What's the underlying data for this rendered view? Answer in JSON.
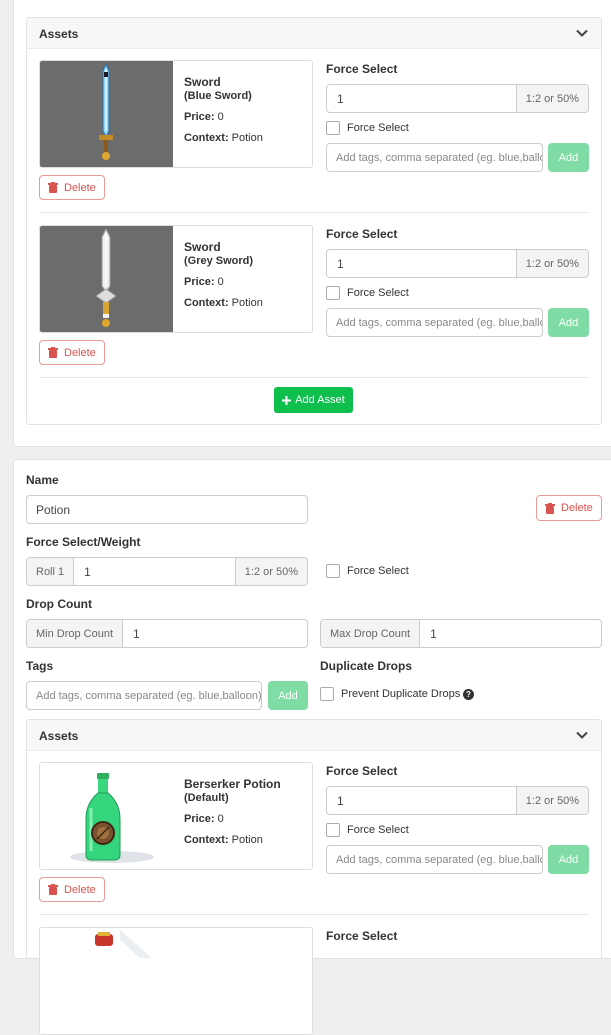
{
  "top_panel": {
    "assets_title": "Assets",
    "assets": [
      {
        "name": "Sword",
        "variant": "(Blue Sword)",
        "price_label": "Price:",
        "price": "0",
        "context_label": "Context:",
        "context": "Potion",
        "force_select_label": "Force Select",
        "weight_value": "1",
        "weight_hint": "1:2 or 50%",
        "force_select_checkbox": "Force Select",
        "tags_placeholder": "Add tags, comma separated (eg. blue,ballo",
        "add_label": "Add",
        "delete_label": "Delete"
      },
      {
        "name": "Sword",
        "variant": "(Grey Sword)",
        "price_label": "Price:",
        "price": "0",
        "context_label": "Context:",
        "context": "Potion",
        "force_select_label": "Force Select",
        "weight_value": "1",
        "weight_hint": "1:2 or 50%",
        "force_select_checkbox": "Force Select",
        "tags_placeholder": "Add tags, comma separated (eg. blue,ballo",
        "add_label": "Add",
        "delete_label": "Delete"
      }
    ],
    "add_asset_label": "Add Asset"
  },
  "group": {
    "name_label": "Name",
    "name_value": "Potion",
    "delete_label": "Delete",
    "force_weight_label": "Force Select/Weight",
    "roll_addon": "Roll 1",
    "roll_value": "1",
    "roll_hint": "1:2 or 50%",
    "force_select_checkbox": "Force Select",
    "drop_count_label": "Drop Count",
    "min_addon": "Min Drop Count",
    "min_value": "1",
    "max_addon": "Max Drop Count",
    "max_value": "1",
    "tags_label": "Tags",
    "tags_placeholder": "Add tags, comma separated (eg. blue,balloon)",
    "tags_add": "Add",
    "duplicate_label": "Duplicate Drops",
    "prevent_duplicate": "Prevent Duplicate Drops",
    "assets_title": "Assets",
    "assets": [
      {
        "name": "Berserker Potion",
        "variant": "(Default)",
        "price_label": "Price:",
        "price": "0",
        "context_label": "Context:",
        "context": "Potion",
        "force_select_label": "Force Select",
        "weight_value": "1",
        "weight_hint": "1:2 or 50%",
        "force_select_checkbox": "Force Select",
        "tags_placeholder": "Add tags, comma separated (eg. blue,ballo",
        "add_label": "Add",
        "delete_label": "Delete"
      },
      {
        "force_select_label": "Force Select"
      }
    ]
  },
  "colors": {
    "add_button": "#7fdca5",
    "primary_green": "#0fbf4d",
    "danger": "#d9534f",
    "sword_bg": "#6c6c6c"
  }
}
